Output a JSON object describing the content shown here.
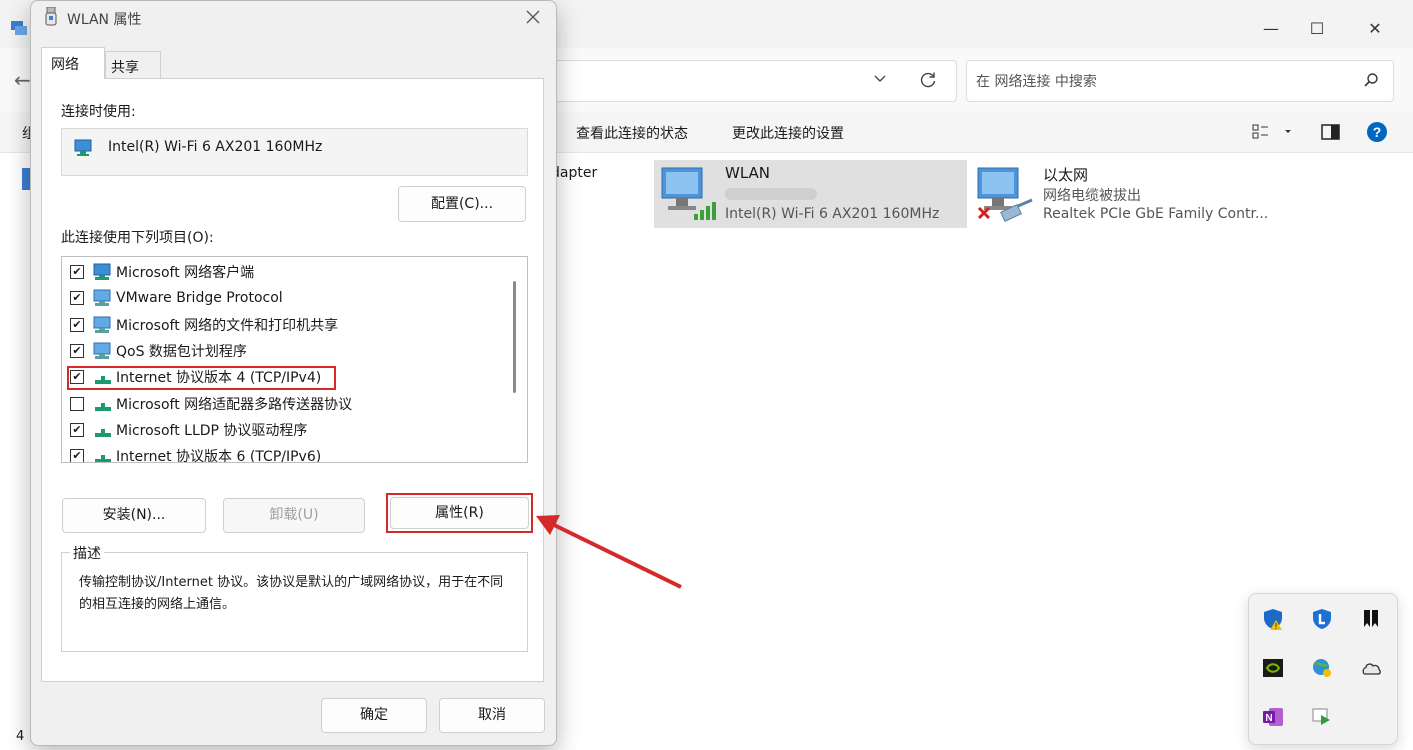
{
  "explorer": {
    "search_placeholder": "在 网络连接 中搜索",
    "cmd_status": "查看此连接的状态",
    "cmd_settings": "更改此连接的设置",
    "partial_left_cmd": "组",
    "partial_adapter_text": "dapter",
    "status_count": "4",
    "connections": [
      {
        "name": "WLAN",
        "status": "",
        "device": "Intel(R) Wi-Fi 6 AX201 160MHz"
      },
      {
        "name": "以太网",
        "status": "网络电缆被拔出",
        "device": "Realtek PCIe GbE Family Contr..."
      }
    ]
  },
  "dialog": {
    "title": "WLAN 属性",
    "tabs": [
      "网络",
      "共享"
    ],
    "connect_using_label": "连接时使用:",
    "adapter_name": "Intel(R) Wi-Fi 6 AX201 160MHz",
    "configure_button": "配置(C)...",
    "items_label": "此连接使用下列项目(O):",
    "items": [
      {
        "label": "Microsoft 网络客户端",
        "checked": true,
        "icon": "network-client-icon"
      },
      {
        "label": "VMware Bridge Protocol",
        "checked": true,
        "icon": "network-service-icon"
      },
      {
        "label": "Microsoft 网络的文件和打印机共享",
        "checked": true,
        "icon": "network-service-icon"
      },
      {
        "label": "QoS 数据包计划程序",
        "checked": true,
        "icon": "network-service-icon"
      },
      {
        "label": "Internet 协议版本 4 (TCP/IPv4)",
        "checked": true,
        "icon": "protocol-icon"
      },
      {
        "label": "Microsoft 网络适配器多路传送器协议",
        "checked": false,
        "icon": "protocol-icon"
      },
      {
        "label": "Microsoft LLDP 协议驱动程序",
        "checked": true,
        "icon": "protocol-icon"
      },
      {
        "label": "Internet 协议版本 6 (TCP/IPv6)",
        "checked": true,
        "icon": "protocol-icon"
      }
    ],
    "install_button": "安装(N)...",
    "uninstall_button": "卸载(U)",
    "properties_button": "属性(R)",
    "description_label": "描述",
    "description_text": "传输控制协议/Internet 协议。该协议是默认的广域网络协议，用于在不同的相互连接的网络上通信。",
    "ok_button": "确定",
    "cancel_button": "取消"
  },
  "colors": {
    "highlight_red": "#d42a2a",
    "accent_blue": "#0067c0"
  }
}
